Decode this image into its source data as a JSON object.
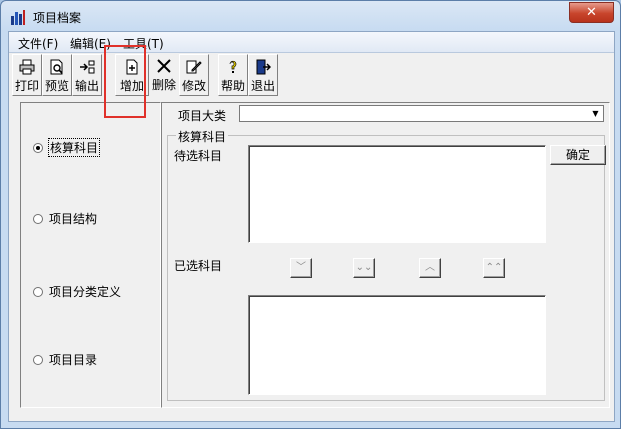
{
  "window": {
    "title": "项目档案",
    "close_label": "✕"
  },
  "menu": [
    {
      "label": "文件(F)"
    },
    {
      "label": "编辑(E)"
    },
    {
      "label": "工具(T)"
    }
  ],
  "toolbar": [
    {
      "label": "打印",
      "icon": "printer-icon"
    },
    {
      "label": "预览",
      "icon": "preview-icon"
    },
    {
      "label": "输出",
      "icon": "export-icon"
    },
    {
      "label": "增加",
      "icon": "add-icon"
    },
    {
      "label": "删除",
      "icon": "delete-icon"
    },
    {
      "label": "修改",
      "icon": "edit-icon"
    },
    {
      "label": "帮助",
      "icon": "help-icon"
    },
    {
      "label": "退出",
      "icon": "exit-icon"
    }
  ],
  "left": {
    "options": [
      {
        "label": "核算科目",
        "selected": true
      },
      {
        "label": "项目结构",
        "selected": false
      },
      {
        "label": "项目分类定义",
        "selected": false
      },
      {
        "label": "项目目录",
        "selected": false
      }
    ]
  },
  "right": {
    "category_label": "项目大类",
    "category_value": "",
    "group_title": "核算科目",
    "pending_label": "待选科目",
    "selected_label": "已选科目",
    "confirm_label": "确定"
  },
  "colors": {
    "highlight": "#e0312a",
    "close": "#c8452c"
  }
}
